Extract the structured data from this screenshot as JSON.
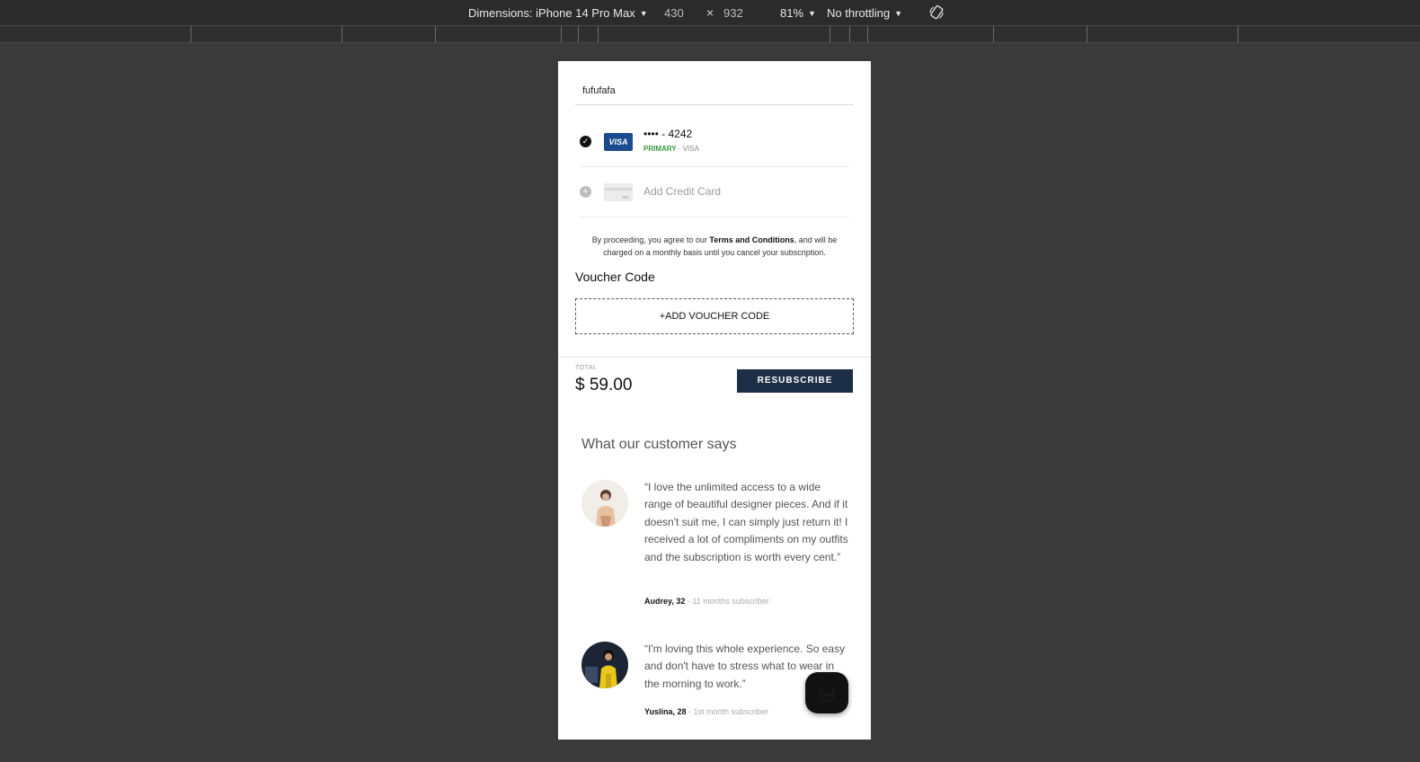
{
  "devtools": {
    "dimensions_label": "Dimensions: iPhone 14 Pro Max",
    "width": "430",
    "times": "×",
    "height": "932",
    "zoom": "81%",
    "throttling": "No throttling",
    "rotate_icon": "rotate-device-icon"
  },
  "checkout": {
    "name_value": "fufufafa",
    "saved_card": {
      "masked": "•••• - 4242",
      "primary_label": "PRIMARY",
      "separator": " · ",
      "brand_label": "VISA",
      "badge": "VISA",
      "selected": true
    },
    "add_card_label": "Add Credit Card",
    "terms": {
      "prefix": "By proceeding, you agree to our ",
      "link": "Terms and Conditions",
      "suffix": ", and will be charged on a monthly basis until you cancel your subscription."
    },
    "voucher_title": "Voucher Code",
    "voucher_button": "+ADD VOUCHER CODE",
    "total_label": "TOTAL",
    "total_value": "$ 59.00",
    "resubscribe_button": "RESUBSCRIBE"
  },
  "testimonials": {
    "title": "What our customer says",
    "items": [
      {
        "quote": "“I love the unlimited access to a wide range of beautiful designer pieces. And if it doesn't suit me, I can simply just return it! I received a lot of compliments on my outfits and the subscription is worth every cent.”",
        "name": "Audrey, 32",
        "meta": " - 11 months subscriber"
      },
      {
        "quote": "“I'm loving this whole experience. So easy and don't have to stress what to wear in the morning to work.”",
        "name": "Yuslina, 28",
        "meta": " - 1st month subscriber"
      }
    ]
  },
  "colors": {
    "primary_button": "#1d2f46",
    "primary_tag": "#3a9a3a",
    "visa_blue": "#1a4b8e"
  }
}
